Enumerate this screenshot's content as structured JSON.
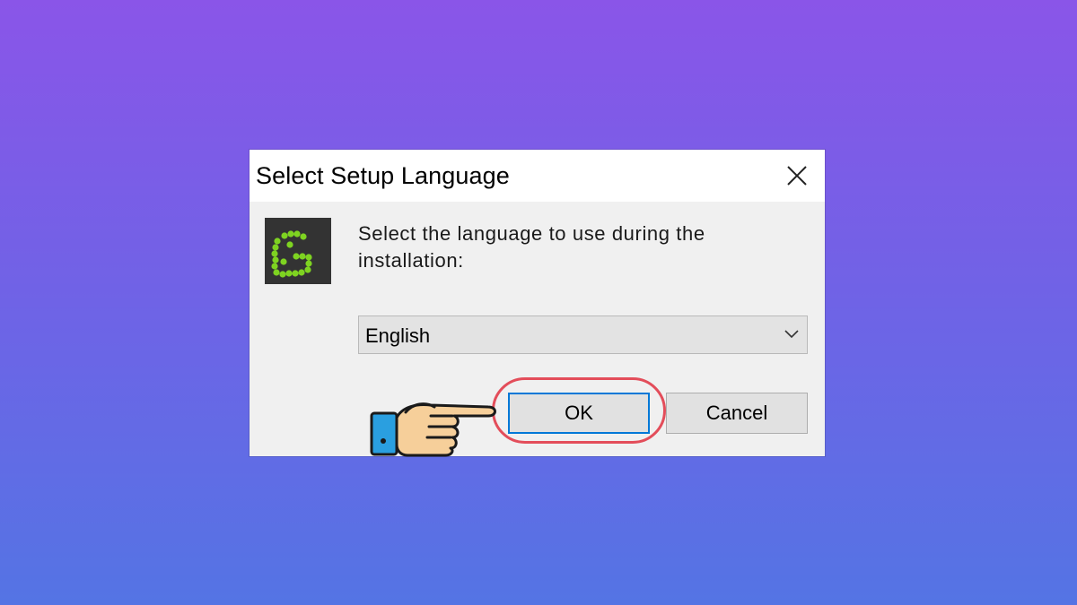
{
  "dialog": {
    "title": "Select Setup Language",
    "close_icon": "close-icon",
    "app_icon": "greenshot-logo",
    "prompt": "Select the language to use during the installation:",
    "language_select": {
      "value": "English"
    },
    "buttons": {
      "ok_label": "OK",
      "cancel_label": "Cancel"
    }
  },
  "annotation": {
    "pointer_icon": "pointing-hand-icon",
    "highlight_color": "#e34d5a"
  },
  "colors": {
    "background_top": "#8a55e8",
    "background_bottom": "#5474e4",
    "dialog_bg": "#f0f0f0",
    "ok_border": "#0078d7",
    "logo_green": "#7ed321"
  }
}
